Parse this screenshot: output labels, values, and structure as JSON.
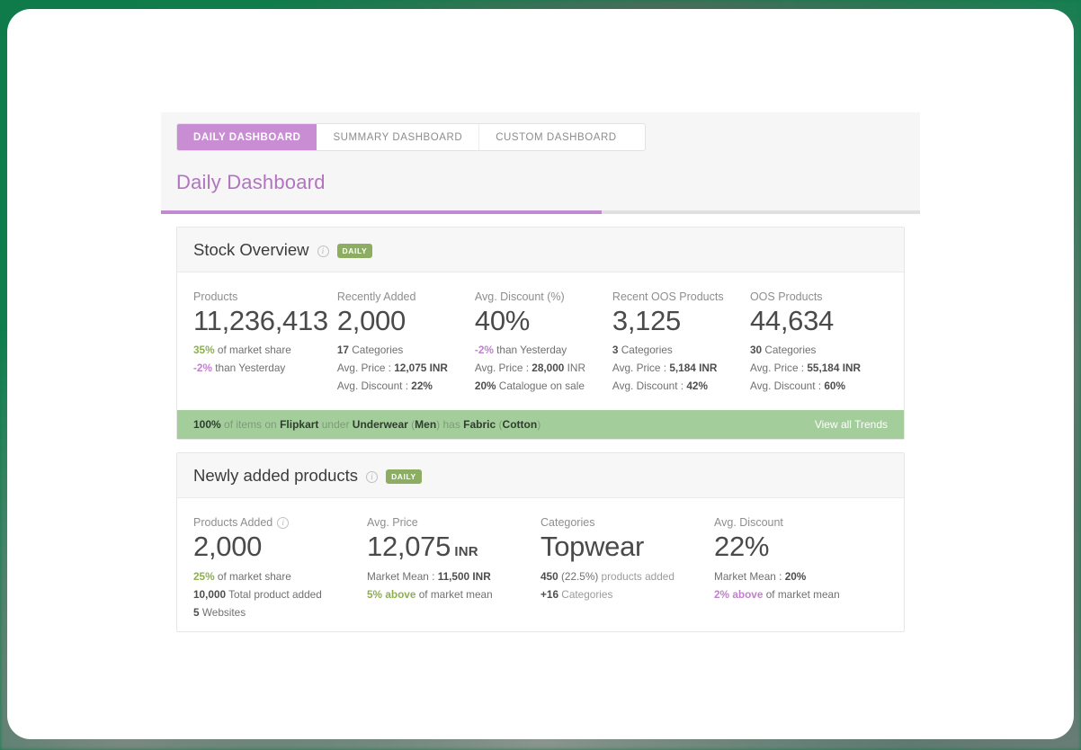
{
  "tabs": [
    {
      "label": "DAILY DASHBOARD",
      "active": true
    },
    {
      "label": "SUMMARY DASHBOARD",
      "active": false
    },
    {
      "label": "CUSTOM DASHBOARD",
      "active": false
    }
  ],
  "page": {
    "title": "Daily Dashboard",
    "progress_percent": 58
  },
  "colors": {
    "accent_purple": "#c18ad0",
    "green": "#8db04f",
    "badge_green": "#8dae62",
    "trend_strip": "#a3ce9b",
    "backdrop_green": "#0f7b4a"
  },
  "cards": [
    {
      "title": "Stock Overview",
      "info_icon": "info-icon",
      "badge": "DAILY",
      "stats": [
        {
          "label": "Products",
          "value": "11,236,413",
          "unit": "",
          "subs": [
            {
              "parts": [
                {
                  "t": "35%",
                  "c": "g"
                },
                {
                  "t": " of market share",
                  "c": ""
                }
              ]
            },
            {
              "parts": [
                {
                  "t": "-2%",
                  "c": "p"
                },
                {
                  "t": " than Yesterday",
                  "c": ""
                }
              ]
            }
          ]
        },
        {
          "label": "Recently Added",
          "value": "2,000",
          "unit": "",
          "subs": [
            {
              "parts": [
                {
                  "t": "17",
                  "c": "b"
                },
                {
                  "t": " Categories",
                  "c": ""
                }
              ]
            },
            {
              "parts": [
                {
                  "t": "Avg. Price : ",
                  "c": ""
                },
                {
                  "t": "12,075 INR",
                  "c": "b"
                }
              ]
            },
            {
              "parts": [
                {
                  "t": "Avg. Discount : ",
                  "c": ""
                },
                {
                  "t": "22%",
                  "c": "b"
                }
              ]
            }
          ]
        },
        {
          "label": "Avg. Discount (%)",
          "value": "40%",
          "unit": "",
          "subs": [
            {
              "parts": [
                {
                  "t": "-2%",
                  "c": "p"
                },
                {
                  "t": " than Yesterday",
                  "c": ""
                }
              ]
            },
            {
              "parts": [
                {
                  "t": "Avg. Price : ",
                  "c": ""
                },
                {
                  "t": "28,000",
                  "c": "b"
                },
                {
                  "t": " INR",
                  "c": ""
                }
              ]
            },
            {
              "parts": [
                {
                  "t": "20%",
                  "c": "b"
                },
                {
                  "t": " Catalogue on sale",
                  "c": ""
                }
              ]
            }
          ]
        },
        {
          "label": "Recent OOS Products",
          "value": "3,125",
          "unit": "",
          "subs": [
            {
              "parts": [
                {
                  "t": "3",
                  "c": "b"
                },
                {
                  "t": " Categories",
                  "c": ""
                }
              ]
            },
            {
              "parts": [
                {
                  "t": "Avg. Price : ",
                  "c": ""
                },
                {
                  "t": "5,184 INR",
                  "c": "b"
                }
              ]
            },
            {
              "parts": [
                {
                  "t": "Avg. Discount : ",
                  "c": ""
                },
                {
                  "t": "42%",
                  "c": "b"
                }
              ]
            }
          ]
        },
        {
          "label": "OOS Products",
          "value": "44,634",
          "unit": "",
          "subs": [
            {
              "parts": [
                {
                  "t": "30",
                  "c": "b"
                },
                {
                  "t": " Categories",
                  "c": ""
                }
              ]
            },
            {
              "parts": [
                {
                  "t": "Avg. Price : ",
                  "c": ""
                },
                {
                  "t": "55,184 INR",
                  "c": "b"
                }
              ]
            },
            {
              "parts": [
                {
                  "t": "Avg. Discount : ",
                  "c": ""
                },
                {
                  "t": "60%",
                  "c": "b"
                }
              ]
            }
          ]
        }
      ],
      "trend": {
        "parts": [
          {
            "t": "100%",
            "c": "k"
          },
          {
            "t": " of items on ",
            "c": ""
          },
          {
            "t": "Flipkart",
            "c": "k"
          },
          {
            "t": " under ",
            "c": ""
          },
          {
            "t": "Underwear",
            "c": "k"
          },
          {
            "t": " (",
            "c": ""
          },
          {
            "t": "Men",
            "c": "k"
          },
          {
            "t": ") has ",
            "c": ""
          },
          {
            "t": "Fabric",
            "c": "k"
          },
          {
            "t": " (",
            "c": ""
          },
          {
            "t": "Cotton",
            "c": "k"
          },
          {
            "t": ")",
            "c": ""
          }
        ],
        "link": "View all Trends"
      }
    },
    {
      "title": "Newly added products",
      "info_icon": "info-icon",
      "badge": "DAILY",
      "stats": [
        {
          "label": "Products Added",
          "has_label_info": true,
          "value": "2,000",
          "unit": "",
          "subs": [
            {
              "parts": [
                {
                  "t": "25%",
                  "c": "g"
                },
                {
                  "t": " of market share",
                  "c": ""
                }
              ]
            },
            {
              "parts": [
                {
                  "t": "10,000",
                  "c": "b"
                },
                {
                  "t": " Total product added",
                  "c": ""
                }
              ]
            },
            {
              "parts": [
                {
                  "t": "5",
                  "c": "b"
                },
                {
                  "t": " Websites",
                  "c": ""
                }
              ]
            }
          ]
        },
        {
          "label": "Avg. Price",
          "value": "12,075",
          "unit": "INR",
          "subs": [
            {
              "parts": [
                {
                  "t": "Market Mean : ",
                  "c": ""
                },
                {
                  "t": "11,500 INR",
                  "c": "b"
                }
              ]
            },
            {
              "parts": [
                {
                  "t": "5% above",
                  "c": "g"
                },
                {
                  "t": " of market mean",
                  "c": ""
                }
              ]
            }
          ]
        },
        {
          "label": "Categories",
          "value": "Topwear",
          "unit": "",
          "subs": [
            {
              "parts": [
                {
                  "t": "450",
                  "c": "b"
                },
                {
                  "t": " (22.5%)",
                  "c": ""
                },
                {
                  "t": " products added",
                  "c": "muted"
                }
              ]
            },
            {
              "parts": [
                {
                  "t": "+16",
                  "c": "b"
                },
                {
                  "t": " Categories",
                  "c": "muted"
                }
              ]
            }
          ]
        },
        {
          "label": "Avg. Discount",
          "value": "22%",
          "unit": "",
          "subs": [
            {
              "parts": [
                {
                  "t": "Market Mean : ",
                  "c": ""
                },
                {
                  "t": "20%",
                  "c": "b"
                }
              ]
            },
            {
              "parts": [
                {
                  "t": "2% above",
                  "c": "p"
                },
                {
                  "t": " of market mean",
                  "c": ""
                }
              ]
            }
          ]
        }
      ]
    }
  ]
}
